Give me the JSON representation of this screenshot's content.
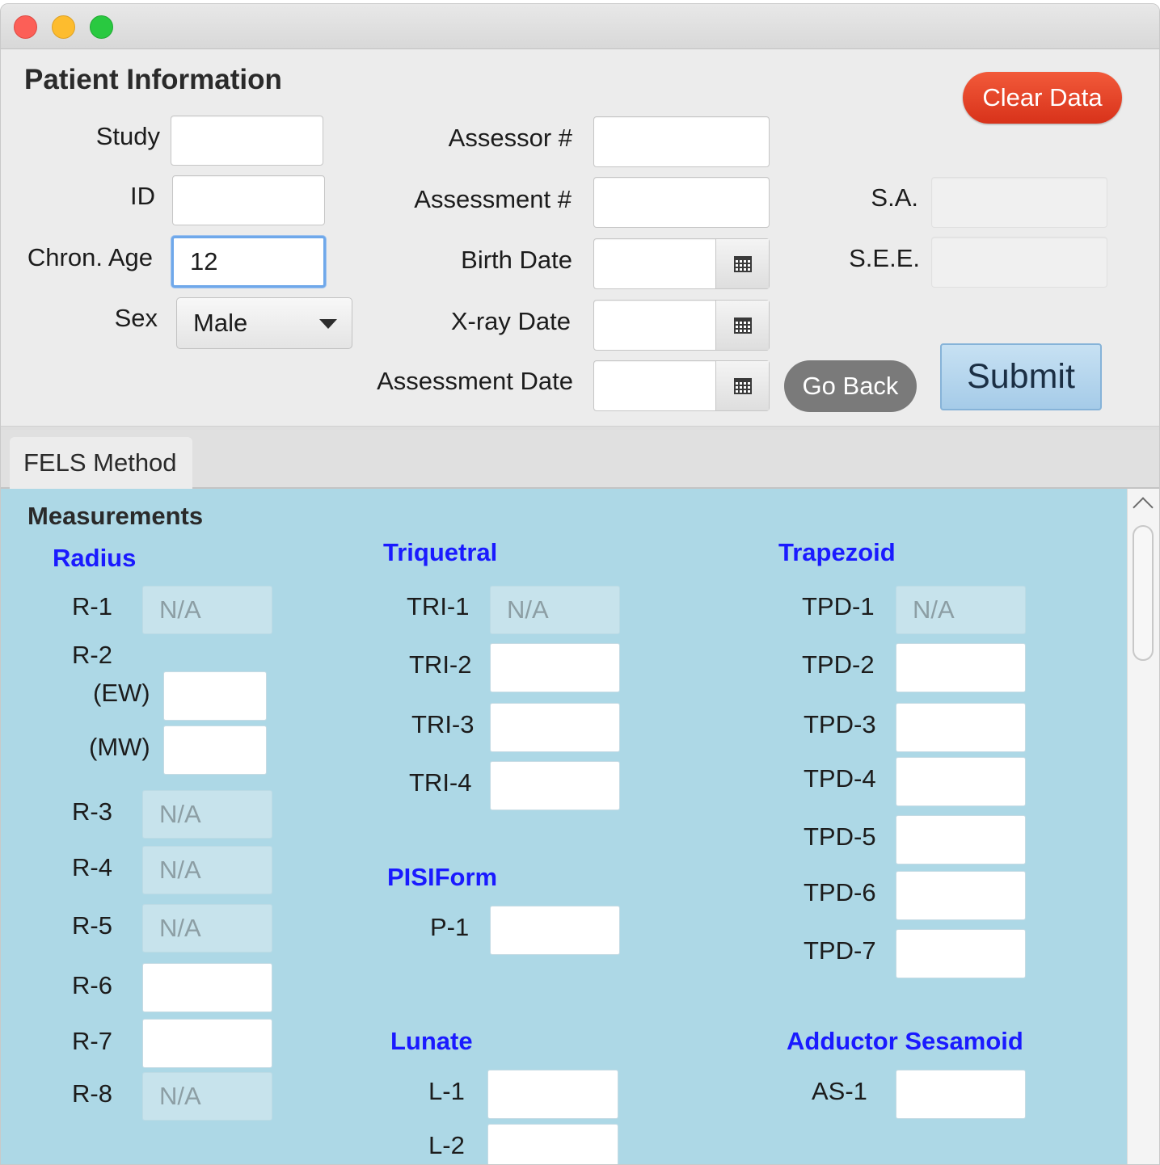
{
  "window": {
    "controls": [
      "close",
      "minimize",
      "maximize"
    ]
  },
  "patient": {
    "title": "Patient Information",
    "study_label": "Study",
    "study_value": "",
    "id_label": "ID",
    "id_value": "",
    "age_label": "Chron. Age",
    "age_value": "12",
    "sex_label": "Sex",
    "sex_value": "Male",
    "assessor_label": "Assessor #",
    "assessor_value": "",
    "assessment_num_label": "Assessment #",
    "assessment_num_value": "",
    "birth_label": "Birth Date",
    "birth_value": "",
    "xray_label": "X-ray Date",
    "xray_value": "",
    "assessment_date_label": "Assessment Date",
    "assessment_date_value": "",
    "sa_label": "S.A.",
    "sa_value": "",
    "see_label": "S.E.E.",
    "see_value": "",
    "clear_label": "Clear Data",
    "goback_label": "Go Back",
    "submit_label": "Submit"
  },
  "tabs": [
    {
      "label": "FELS Method",
      "selected": true
    }
  ],
  "measurements": {
    "title": "Measurements",
    "radius": {
      "title": "Radius",
      "r1_label": "R-1",
      "r1_value": "N/A",
      "r2_label": "R-2",
      "ew_label": "(EW)",
      "ew_value": "",
      "mw_label": "(MW)",
      "mw_value": "",
      "r3_label": "R-3",
      "r3_value": "N/A",
      "r4_label": "R-4",
      "r4_value": "N/A",
      "r5_label": "R-5",
      "r5_value": "N/A",
      "r6_label": "R-6",
      "r6_value": "",
      "r7_label": "R-7",
      "r7_value": "",
      "r8_label": "R-8",
      "r8_value": "N/A"
    },
    "triquetral": {
      "title": "Triquetral",
      "tri1_label": "TRI-1",
      "tri1_value": "N/A",
      "tri2_label": "TRI-2",
      "tri2_value": "",
      "tri3_label": "TRI-3",
      "tri3_value": "",
      "tri4_label": "TRI-4",
      "tri4_value": ""
    },
    "pisiform": {
      "title": "PISIForm",
      "p1_label": "P-1",
      "p1_value": ""
    },
    "lunate": {
      "title": "Lunate",
      "l1_label": "L-1",
      "l1_value": "",
      "l2_label": "L-2",
      "l2_value": ""
    },
    "trapezoid": {
      "title": "Trapezoid",
      "tpd1_label": "TPD-1",
      "tpd1_value": "N/A",
      "tpd2_label": "TPD-2",
      "tpd2_value": "",
      "tpd3_label": "TPD-3",
      "tpd3_value": "",
      "tpd4_label": "TPD-4",
      "tpd4_value": "",
      "tpd5_label": "TPD-5",
      "tpd5_value": "",
      "tpd6_label": "TPD-6",
      "tpd6_value": "",
      "tpd7_label": "TPD-7",
      "tpd7_value": ""
    },
    "adductor": {
      "title": "Adductor Sesamoid",
      "as1_label": "AS-1",
      "as1_value": ""
    }
  },
  "colors": {
    "panel_bg": "#add8e6",
    "section_title": "#1a1aff",
    "clear_button": "#e0401f",
    "submit_button": "#b7d7ee",
    "goback_button": "#7a7a7a"
  }
}
